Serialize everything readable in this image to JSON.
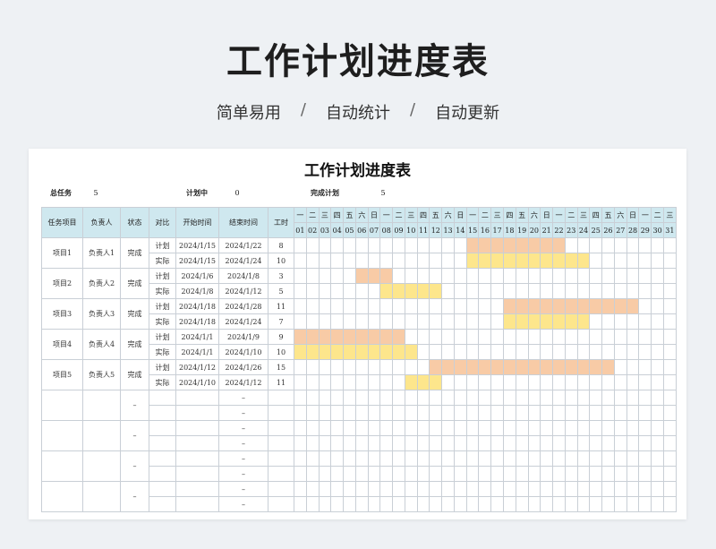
{
  "hero": {
    "title": "工作计划进度表",
    "subtitle": [
      "简单易用",
      "自动统计",
      "自动更新"
    ],
    "separator": "/"
  },
  "sheet": {
    "title": "工作计划进度表",
    "summary": [
      {
        "label": "总任务",
        "value": "5"
      },
      {
        "label": "计划中",
        "value": "0"
      },
      {
        "label": "完成计划",
        "value": "5"
      }
    ],
    "headers": [
      "任务项目",
      "负责人",
      "状态",
      "对比",
      "开始时间",
      "结束时间",
      "工时"
    ],
    "weekdays": [
      "一",
      "二",
      "三",
      "四",
      "五",
      "六",
      "日",
      "一",
      "二",
      "三",
      "四",
      "五",
      "六",
      "日",
      "一",
      "二",
      "三",
      "四",
      "五",
      "六",
      "日",
      "一",
      "二",
      "三",
      "四",
      "五",
      "六",
      "日",
      "一",
      "二",
      "三"
    ],
    "days": [
      "01",
      "02",
      "03",
      "04",
      "05",
      "06",
      "07",
      "08",
      "09",
      "10",
      "11",
      "12",
      "13",
      "14",
      "15",
      "16",
      "17",
      "18",
      "19",
      "20",
      "21",
      "22",
      "23",
      "24",
      "25",
      "26",
      "27",
      "28",
      "29",
      "30",
      "31"
    ],
    "colors": {
      "plan": "#f8cba6",
      "actual": "#fde68c",
      "header": "#cfe8ef"
    },
    "tasks": [
      {
        "name": "项目1",
        "owner": "负责人1",
        "status": "完成",
        "plan": {
          "label": "计划",
          "start": "2024/1/15",
          "end": "2024/1/22",
          "hours": "8"
        },
        "actual": {
          "label": "实际",
          "start": "2024/1/15",
          "end": "2024/1/24",
          "hours": "10"
        }
      },
      {
        "name": "项目2",
        "owner": "负责人2",
        "status": "完成",
        "plan": {
          "label": "计划",
          "start": "2024/1/6",
          "end": "2024/1/8",
          "hours": "3"
        },
        "actual": {
          "label": "实际",
          "start": "2024/1/8",
          "end": "2024/1/12",
          "hours": "5"
        }
      },
      {
        "name": "项目3",
        "owner": "负责人3",
        "status": "完成",
        "plan": {
          "label": "计划",
          "start": "2024/1/18",
          "end": "2024/1/28",
          "hours": "11"
        },
        "actual": {
          "label": "实际",
          "start": "2024/1/18",
          "end": "2024/1/24",
          "hours": "7"
        }
      },
      {
        "name": "项目4",
        "owner": "负责人4",
        "status": "完成",
        "plan": {
          "label": "计划",
          "start": "2024/1/1",
          "end": "2024/1/9",
          "hours": "9"
        },
        "actual": {
          "label": "实际",
          "start": "2024/1/1",
          "end": "2024/1/10",
          "hours": "10"
        }
      },
      {
        "name": "项目5",
        "owner": "负责人5",
        "status": "完成",
        "plan": {
          "label": "计划",
          "start": "2024/1/12",
          "end": "2024/1/26",
          "hours": "15"
        },
        "actual": {
          "label": "实际",
          "start": "2024/1/10",
          "end": "2024/1/12",
          "hours": "11"
        }
      }
    ],
    "empty_rows": 4,
    "placeholder": "–"
  }
}
